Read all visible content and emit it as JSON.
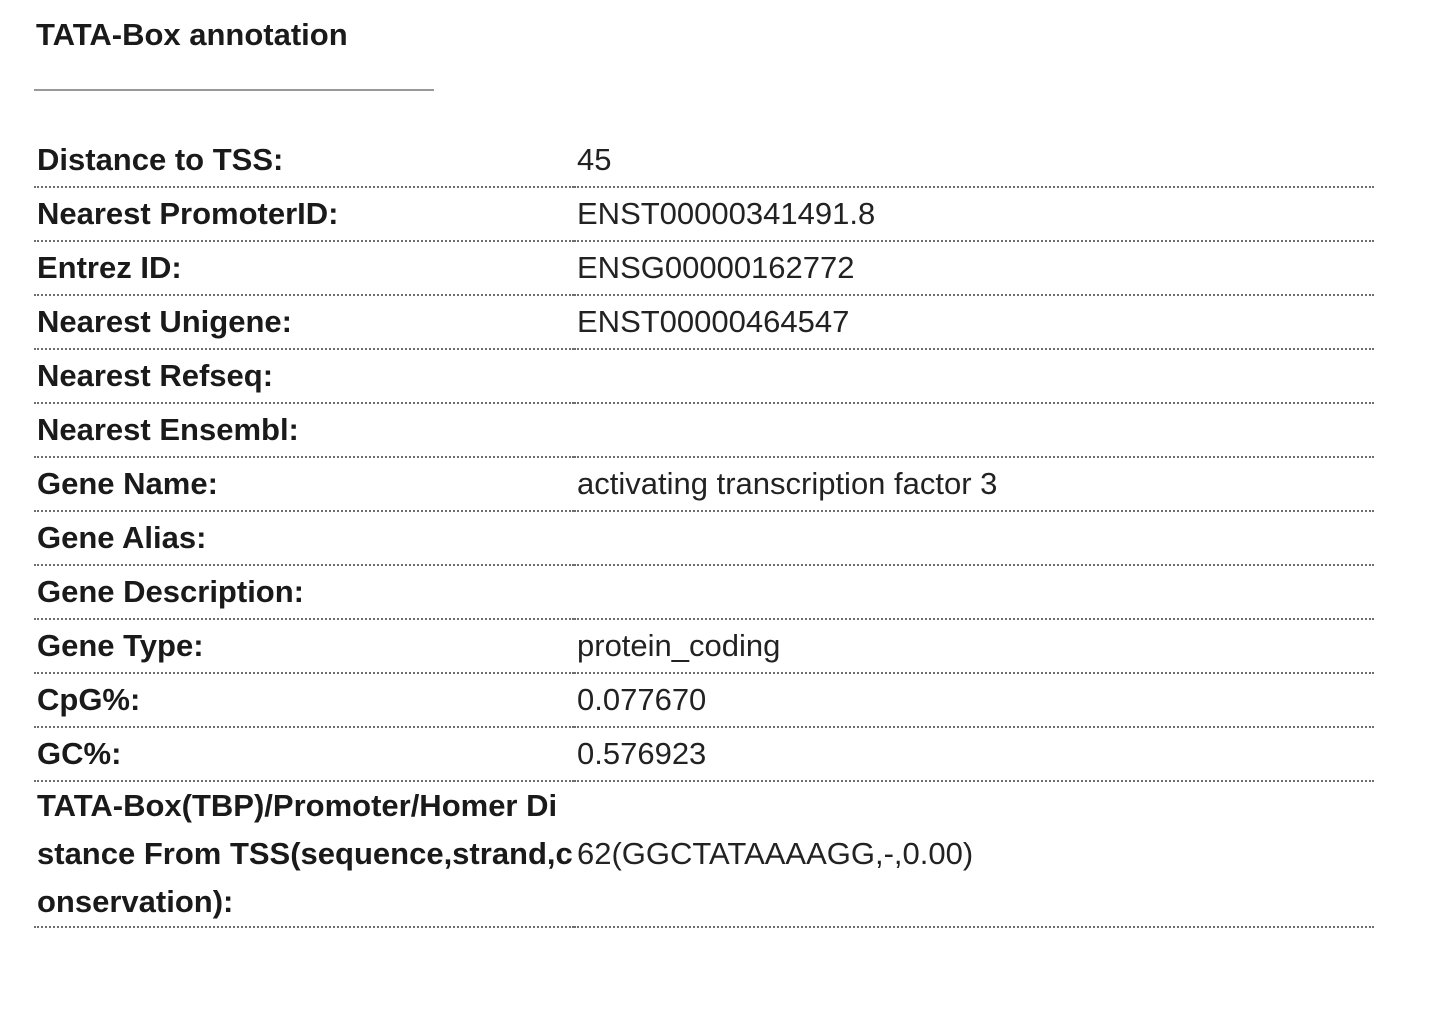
{
  "panel": {
    "title": "TATA-Box annotation"
  },
  "rows": [
    {
      "label": "Distance to TSS:",
      "value": "45"
    },
    {
      "label": "Nearest PromoterID:",
      "value": "ENST00000341491.8"
    },
    {
      "label": "Entrez ID:",
      "value": "ENSG00000162772"
    },
    {
      "label": "Nearest Unigene:",
      "value": "ENST00000464547"
    },
    {
      "label": "Nearest Refseq:",
      "value": ""
    },
    {
      "label": "Nearest Ensembl:",
      "value": ""
    },
    {
      "label": "Gene Name:",
      "value": "activating transcription factor 3"
    },
    {
      "label": "Gene Alias:",
      "value": ""
    },
    {
      "label": "Gene Description:",
      "value": ""
    },
    {
      "label": "Gene Type:",
      "value": "protein_coding"
    },
    {
      "label": "CpG%:",
      "value": "0.077670"
    },
    {
      "label": "GC%:",
      "value": "0.576923"
    },
    {
      "label": "TATA-Box(TBP)/Promoter/Homer Distance From TSS(sequence,strand,conservation):",
      "value": "62(GGCTATAAAAGG,-,0.00)"
    }
  ]
}
